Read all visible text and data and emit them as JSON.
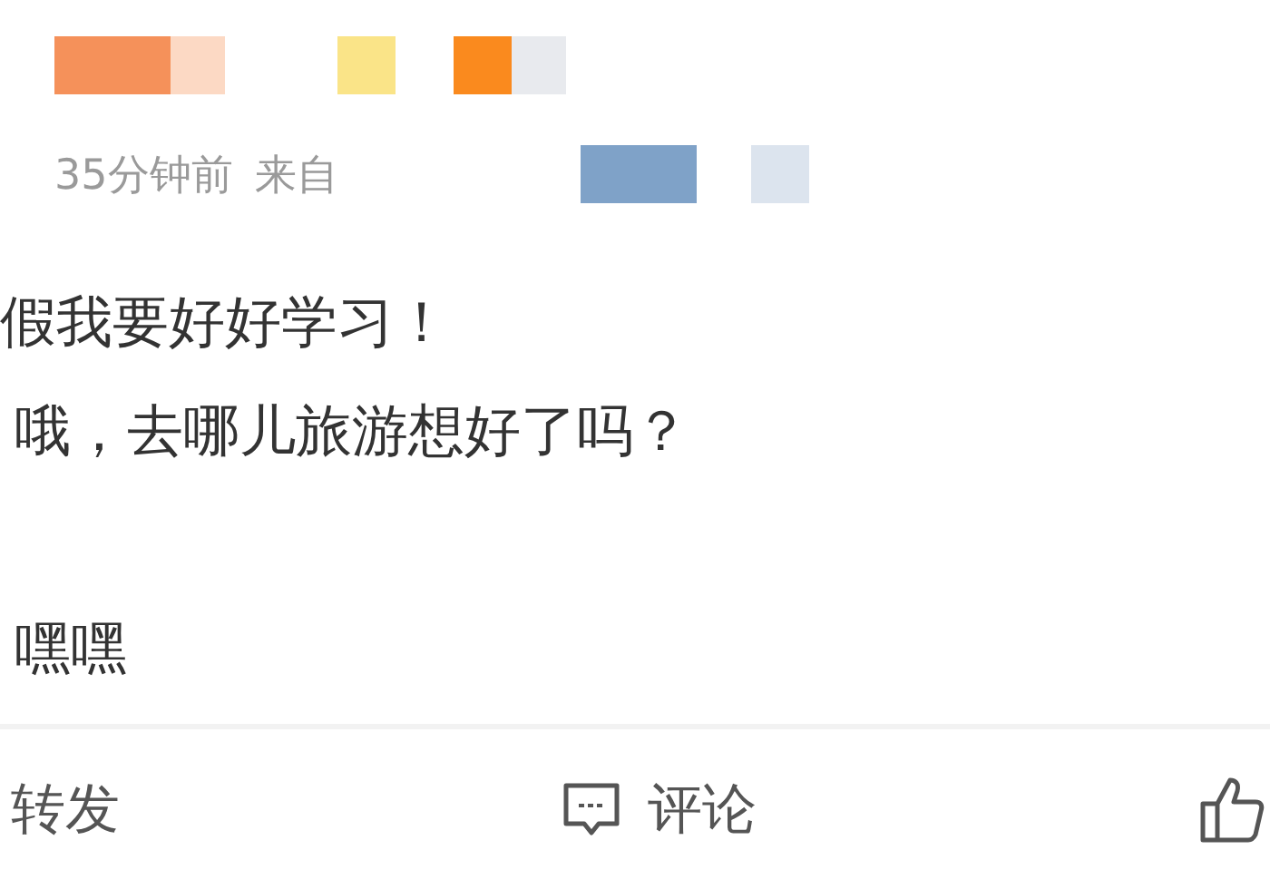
{
  "post": {
    "time": "35分钟前",
    "source_prefix": "来自",
    "lines": [
      {
        "text": "假我要好好学习！",
        "gap_before": false
      },
      {
        "text": "哦，去哪儿旅游想好了吗？",
        "gap_before": false
      },
      {
        "text": "嘿嘿",
        "gap_before": true
      }
    ]
  },
  "actions": [
    {
      "kind": "repost",
      "label": "转发"
    },
    {
      "kind": "comment",
      "label": "评论"
    },
    {
      "kind": "like"
    }
  ]
}
